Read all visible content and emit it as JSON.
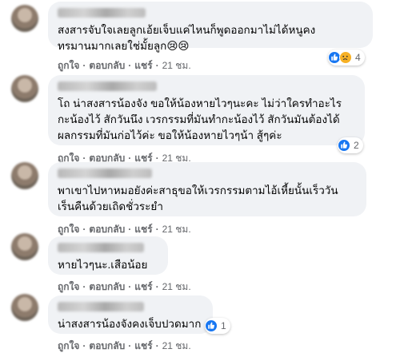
{
  "comments": [
    {
      "text": "สงสารจับใจเลยลูกเอ้ยเจ็บแค่ไหนก็พูดออกมาไม่ได้หนูคง\nทรมานมากเลยใช่มั้ยลูก😢😢",
      "actions": {
        "like": "ถูกใจ",
        "reply": "ตอบกลับ",
        "share": "แชร์",
        "time": "21 ชม."
      },
      "reactions": {
        "icons": [
          "like-icon",
          "sad-icon"
        ],
        "count": "4"
      }
    },
    {
      "text": "โถ น่าสงสารน้องจัง ขอให้น้องหายไวๆนะคะ ไม่ว่าใครทำอะไร\nกะน้องไว้ สักวันนึง เวรกรรมที่มันทำกะน้องไว้ สักวันมันต้องได้\nผลกรรมที่มันก่อไว้ค่ะ ขอให้น้องหายไวๆน้า สู้ๆค่ะ",
      "actions": {
        "like": "ถูกใจ",
        "reply": "ตอบกลับ",
        "share": "แชร์",
        "time": "21 ชม."
      },
      "reactions": {
        "icons": [
          "like-icon"
        ],
        "count": "2"
      }
    },
    {
      "text": "พาเขาไปหาหมอยังค่ะสาธุขอให้เวรกรรมตามไอ้เหี้ยนั้นเร็ววัน\nเร็นคืนด้วยเถิดชั่วระยำ",
      "actions": {
        "like": "ถูกใจ",
        "reply": "ตอบกลับ",
        "share": "แชร์",
        "time": "21 ชม."
      },
      "reactions": null
    },
    {
      "text": "หายไวๆนะ.เสือน้อย",
      "actions": {
        "like": "ถูกใจ",
        "reply": "ตอบกลับ",
        "share": "แชร์",
        "time": "21 ชม."
      },
      "reactions": null
    },
    {
      "text": "น่าสงสารน้องจังคงเจ็บปวดมาก",
      "actions": {
        "like": "ถูกใจ",
        "reply": "ตอบกลับ",
        "share": "แชร์",
        "time": "21 ชม."
      },
      "reactions": {
        "icons": [
          "like-icon"
        ],
        "count": "1"
      }
    }
  ],
  "colors": {
    "bubble": "#f0f2f5",
    "like": "#1877f2",
    "sad": "#f7b125",
    "meta": "#65676b"
  }
}
